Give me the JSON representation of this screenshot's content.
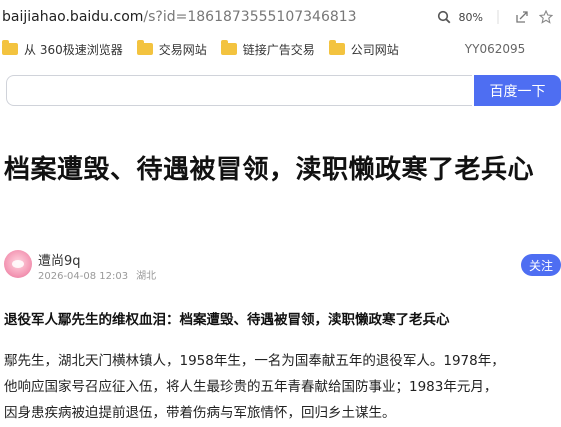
{
  "browser": {
    "url_host": "baijiahao.baidu.com",
    "url_rest": "/s?id=1861873555107346813",
    "zoom": "80%"
  },
  "bookmarks": [
    {
      "label": "从 360极速浏览器",
      "icon": "folder-icon"
    },
    {
      "label": "交易网站",
      "icon": "folder-icon"
    },
    {
      "label": "链接广告交易",
      "icon": "folder-icon"
    },
    {
      "label": "公司网站",
      "icon": "folder-icon"
    }
  ],
  "bookmark_code": "YY062095",
  "search": {
    "placeholder": "",
    "button_label": "百度一下"
  },
  "article": {
    "title": "档案遭毁、待遇被冒领，渎职懒政寒了老兵心",
    "author": "遭尚9q",
    "date": "2026-04-08 12:03",
    "location": "湖北",
    "follow_label": "关注",
    "subtitle": "退役军人鄢先生的维权血泪：档案遭毁、待遇被冒领，渎职懒政寒了老兵心",
    "body_lines": [
      "鄢先生，湖北天门横林镇人，1958年生，一名为国奉献五年的退役军人。1978年，",
      "他响应国家号召应征入伍，将人生最珍贵的五年青春献给国防事业；1983年元月，",
      "因身患疾病被迫提前退伍，带着伤病与军旅情怀，回归乡土谋生。"
    ]
  },
  "colors": {
    "accent": "#4e6ef2",
    "folder": "#f3c33f"
  }
}
